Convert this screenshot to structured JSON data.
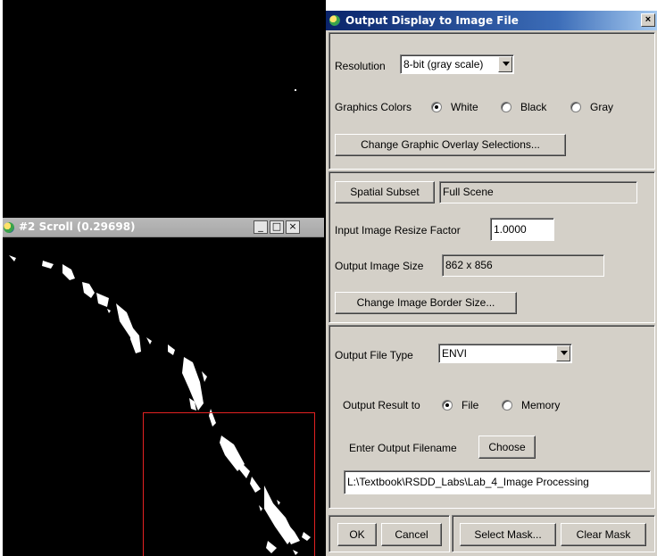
{
  "scroll_window": {
    "title": "#2 Scroll (0.29698)",
    "buttons": {
      "minimize": "_",
      "maximize": "□",
      "close": "×"
    }
  },
  "dialog": {
    "title": "Output Display to Image File",
    "close_label": "×",
    "resolution": {
      "label": "Resolution",
      "value": "8-bit (gray scale)"
    },
    "graphics_colors": {
      "label": "Graphics Colors",
      "options": [
        "White",
        "Black",
        "Gray"
      ],
      "selected": "White"
    },
    "overlay_button": "Change Graphic Overlay Selections...",
    "spatial_subset": {
      "button": "Spatial Subset",
      "value": "Full Scene"
    },
    "resize_factor": {
      "label": "Input Image Resize Factor",
      "value": "1.0000"
    },
    "output_size": {
      "label": "Output Image Size",
      "value": "862 x 856"
    },
    "border_button": "Change Image Border Size...",
    "file_type": {
      "label": "Output File Type",
      "value": "ENVI"
    },
    "output_result": {
      "label": "Output Result to",
      "options": [
        "File",
        "Memory"
      ],
      "selected": "File"
    },
    "filename": {
      "label": "Enter Output Filename",
      "choose": "Choose",
      "value": "L:\\Textbook\\RSDD_Labs\\Lab_4_Image Processing"
    },
    "footer": {
      "ok": "OK",
      "cancel": "Cancel",
      "select_mask": "Select Mask...",
      "clear_mask": "Clear Mask"
    }
  }
}
